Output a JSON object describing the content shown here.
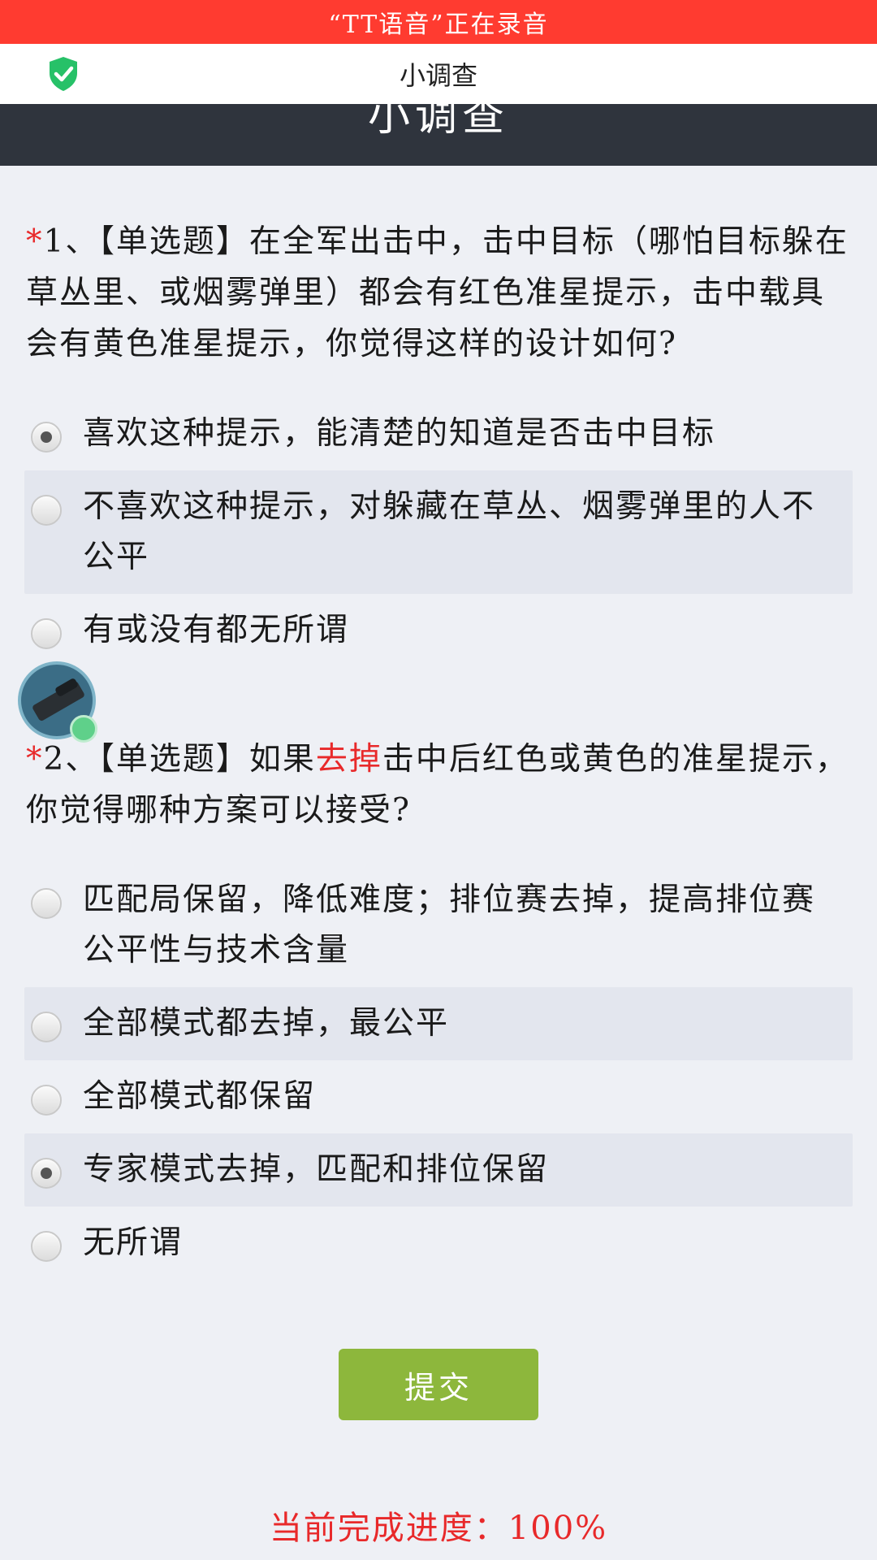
{
  "status": {
    "recording_text": "“TT语音”正在录音"
  },
  "nav": {
    "title": "小调查",
    "shield_icon": "shield-check-icon"
  },
  "header": {
    "title": "小调查"
  },
  "questions": [
    {
      "required_mark": "*",
      "text": "1、【单选题】在全军出击中，击中目标（哪怕目标躲在草丛里、或烟雾弹里）都会有红色准星提示，击中载具会有黄色准星提示，你觉得这样的设计如何?",
      "options": [
        {
          "label": "喜欢这种提示，能清楚的知道是否击中目标",
          "checked": true
        },
        {
          "label": "不喜欢这种提示，对躲藏在草丛、烟雾弹里的人不公平",
          "checked": false
        },
        {
          "label": "有或没有都无所谓",
          "checked": false
        }
      ]
    },
    {
      "required_mark": "*",
      "text_before": "2、【单选题】如果",
      "text_emphasis": "去掉",
      "text_after": "击中后红色或黄色的准星提示，你觉得哪种方案可以接受?",
      "options": [
        {
          "label": "匹配局保留，降低难度；排位赛去掉，提高排位赛公平性与技术含量",
          "checked": false
        },
        {
          "label": "全部模式都去掉，最公平",
          "checked": false
        },
        {
          "label": "全部模式都保留",
          "checked": false
        },
        {
          "label": "专家模式去掉，匹配和排位保留",
          "checked": true
        },
        {
          "label": "无所谓",
          "checked": false
        }
      ]
    }
  ],
  "submit_label": "提交",
  "progress_text": "当前完成进度：100%",
  "colors": {
    "recording_bar": "#ff3b30",
    "header_dark": "#2f343d",
    "accent_red": "#e8292a",
    "submit_green": "#8db73c"
  }
}
